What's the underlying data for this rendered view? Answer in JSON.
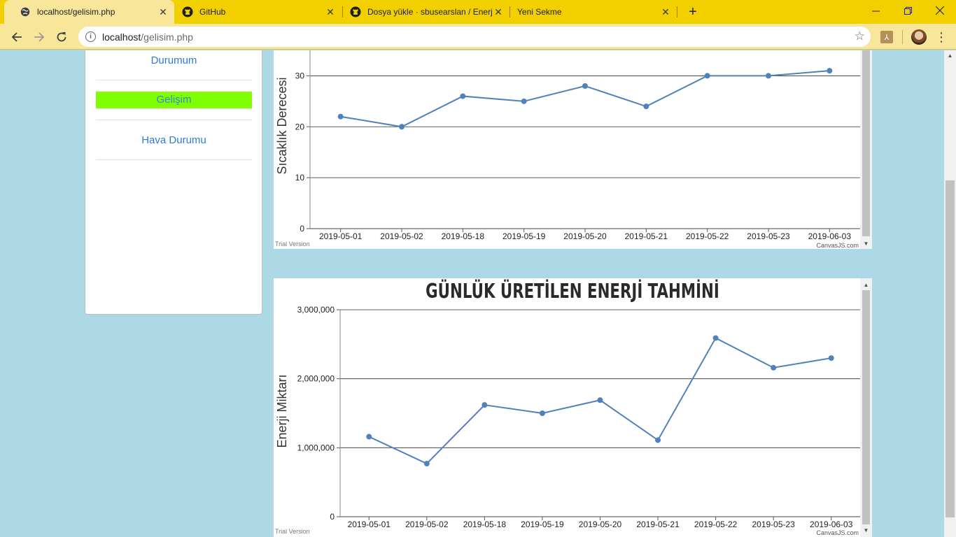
{
  "browser": {
    "tabs": [
      {
        "title": "localhost/gelisim.php",
        "icon": "globe-icon",
        "active": true
      },
      {
        "title": "GitHub",
        "icon": "github-icon",
        "active": false
      },
      {
        "title": "Dosya yükle · sbusearslan / Enerj",
        "icon": "github-icon",
        "active": false
      },
      {
        "title": "Yeni Sekme",
        "icon": "",
        "active": false
      }
    ],
    "url_host": "localhost",
    "url_path": "/gelisim.php",
    "accent": "#f2d000"
  },
  "sidebar": {
    "items": [
      {
        "label": "Durumum",
        "active": false
      },
      {
        "label": "Gelişim",
        "active": true
      },
      {
        "label": "Hava Durumu",
        "active": false
      }
    ],
    "active_color": "#80ff00",
    "link_color": "#2d7ccf"
  },
  "chart_data": [
    {
      "type": "line",
      "title": "",
      "xlabel": "",
      "ylabel": "Sıcaklık Derecesi",
      "categories": [
        "2019-05-01",
        "2019-05-02",
        "2019-05-18",
        "2019-05-19",
        "2019-05-20",
        "2019-05-21",
        "2019-05-22",
        "2019-05-23",
        "2019-06-03"
      ],
      "values": [
        22,
        20,
        26,
        25,
        28,
        24,
        30,
        30,
        31
      ],
      "ylim": [
        0,
        35
      ],
      "yticks": [
        0,
        10,
        20,
        30
      ],
      "ytick_labels": [
        "0",
        "10",
        "20",
        "30"
      ],
      "grid": true,
      "line_color": "#4f81bc",
      "watermark_left": "Trial Version",
      "watermark_right": "CanvasJS.com"
    },
    {
      "type": "line",
      "title": "GÜNLÜK ÜRETİLEN ENERJİ TAHMİNİ",
      "xlabel": "",
      "ylabel": "Enerji Miktarı",
      "categories": [
        "2019-05-01",
        "2019-05-02",
        "2019-05-18",
        "2019-05-19",
        "2019-05-20",
        "2019-05-21",
        "2019-05-22",
        "2019-05-23",
        "2019-06-03"
      ],
      "values": [
        1160000,
        770000,
        1620000,
        1500000,
        1690000,
        1110000,
        2590000,
        2160000,
        2300000
      ],
      "ylim": [
        0,
        3000000
      ],
      "yticks": [
        0,
        1000000,
        2000000,
        3000000
      ],
      "ytick_labels": [
        "0",
        "1,000,000",
        "2,000,000",
        "3,000,000"
      ],
      "grid": true,
      "line_color": "#4f81bc",
      "watermark_left": "Trial Version",
      "watermark_right": "CanvasJS.com"
    }
  ]
}
